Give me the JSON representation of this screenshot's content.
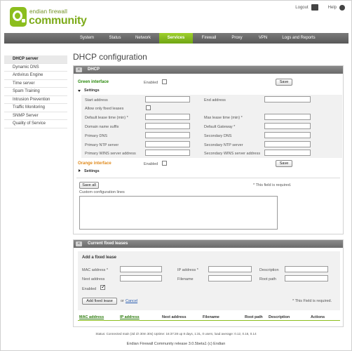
{
  "brand": {
    "line1": "endian firewall",
    "line2": "community"
  },
  "top_links": {
    "logout": "Logout",
    "help": "Help"
  },
  "nav": {
    "items": [
      {
        "label": "System"
      },
      {
        "label": "Status"
      },
      {
        "label": "Network"
      },
      {
        "label": "Services",
        "active": true
      },
      {
        "label": "Firewall"
      },
      {
        "label": "Proxy"
      },
      {
        "label": "VPN"
      },
      {
        "label": "Logs and Reports"
      }
    ]
  },
  "sidebar": {
    "items": [
      {
        "label": "DHCP server",
        "active": true
      },
      {
        "label": "Dynamic DNS"
      },
      {
        "label": "Antivirus Engine"
      },
      {
        "label": "Time server"
      },
      {
        "label": "Spam Training"
      },
      {
        "label": "Intrusion Prevention"
      },
      {
        "label": "Traffic Monitoring"
      },
      {
        "label": "SNMP Server"
      },
      {
        "label": "Quality of Service"
      }
    ]
  },
  "page_title": "DHCP configuration",
  "dhcp_panel": {
    "toggle": "«",
    "title": "DHCP",
    "green_interface": "Green interface",
    "enabled_label": "Enabled",
    "save_label": "Save",
    "settings_label": "Settings",
    "fields": {
      "start_address": "Start address",
      "end_address": "End address",
      "allow_only_fixed": "Allow only fixed leases",
      "default_lease": "Default lease time (min) *",
      "max_lease": "Max lease time (min) *",
      "domain_suffix": "Domain name suffix",
      "default_gateway": "Default Gateway *",
      "primary_dns": "Primary DNS",
      "secondary_dns": "Secondary DNS",
      "primary_ntp": "Primary NTP server",
      "secondary_ntp": "Secondary NTP server",
      "primary_wins": "Primary WINS server address",
      "secondary_wins": "Secondary WINS server address"
    },
    "orange_interface": "Orange interface",
    "save_all_label": "Save all",
    "required_note": "* This field is required.",
    "custom_config_label": "Custom configuration lines"
  },
  "fixed_panel": {
    "toggle": "«",
    "title": "Current fixed leases",
    "add_heading": "Add a fixed lease",
    "mac_label": "MAC address *",
    "ip_label": "IP address *",
    "description_label": "Description",
    "next_address_label": "Next address",
    "filename_label": "Filename",
    "root_path_label": "Root path",
    "enabled_label": "Enabled",
    "add_button": "Add fixed lease",
    "or_text": "or",
    "cancel_link": "Cancel",
    "required_note": "* This Field is required.",
    "columns": [
      "MAC address",
      "IP address",
      "Next address",
      "Filename",
      "Root path",
      "Description",
      "Actions"
    ]
  },
  "footer": {
    "status": "Status: Connected  main (3d 1h 30m 30s)  Uptime: 16:37:28 up 8 days, 1:31, 0 users, load average: 0.12, 0.16, 0.14",
    "release": "Endian Firewall Community release 3.0.5beta1 (c) Endian"
  }
}
